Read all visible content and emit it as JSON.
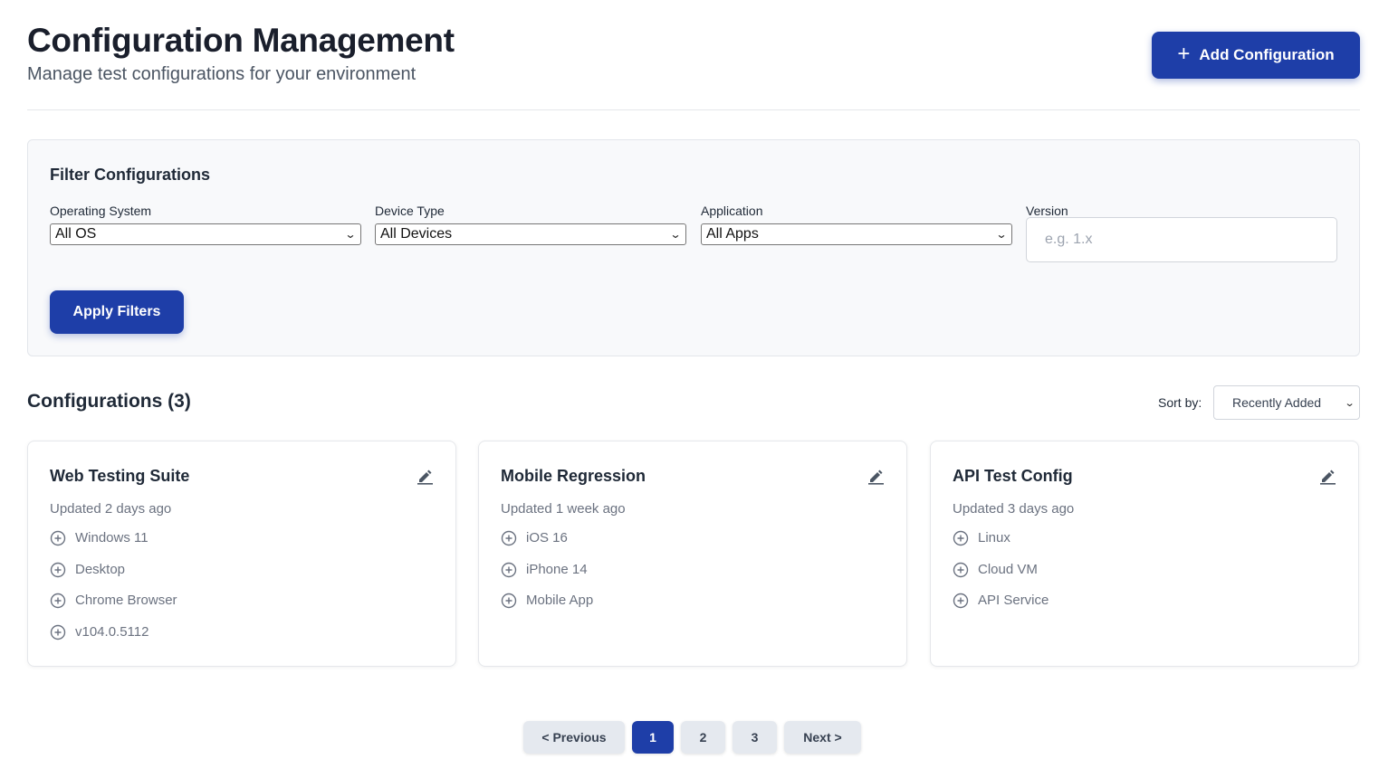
{
  "header": {
    "title": "Configuration Management",
    "subtitle": "Manage test configurations for your environment",
    "add_button_label": "Add Configuration",
    "add_button_icon": "plus-icon"
  },
  "filters": {
    "title": "Filter Configurations",
    "os": {
      "label": "Operating System",
      "value": "All OS"
    },
    "device": {
      "label": "Device Type",
      "value": "All Devices"
    },
    "application": {
      "label": "Application",
      "value": "All Apps"
    },
    "version": {
      "label": "Version",
      "placeholder": "e.g. 1.x",
      "value": ""
    },
    "apply_label": "Apply Filters"
  },
  "list": {
    "title": "Configurations (3)",
    "sort_label": "Sort by:",
    "sort_value": "Recently Added"
  },
  "configurations": [
    {
      "name": "Web Testing Suite",
      "updated": "Updated 2 days ago",
      "items": [
        "Windows 11",
        "Desktop",
        "Chrome Browser",
        "v104.0.5112"
      ]
    },
    {
      "name": "Mobile Regression",
      "updated": "Updated 1 week ago",
      "items": [
        "iOS 16",
        "iPhone 14",
        "Mobile App"
      ]
    },
    {
      "name": "API Test Config",
      "updated": "Updated 3 days ago",
      "items": [
        "Linux",
        "Cloud VM",
        "API Service"
      ]
    }
  ],
  "pagination": {
    "previous_label": "< Previous",
    "pages": [
      "1",
      "2",
      "3"
    ],
    "current_page": "1",
    "next_label": "Next >"
  },
  "colors": {
    "primary": "#1e3ea8",
    "text_dark": "#1f2937",
    "text_muted": "#6b7280",
    "panel_bg": "#f8f9fb"
  }
}
